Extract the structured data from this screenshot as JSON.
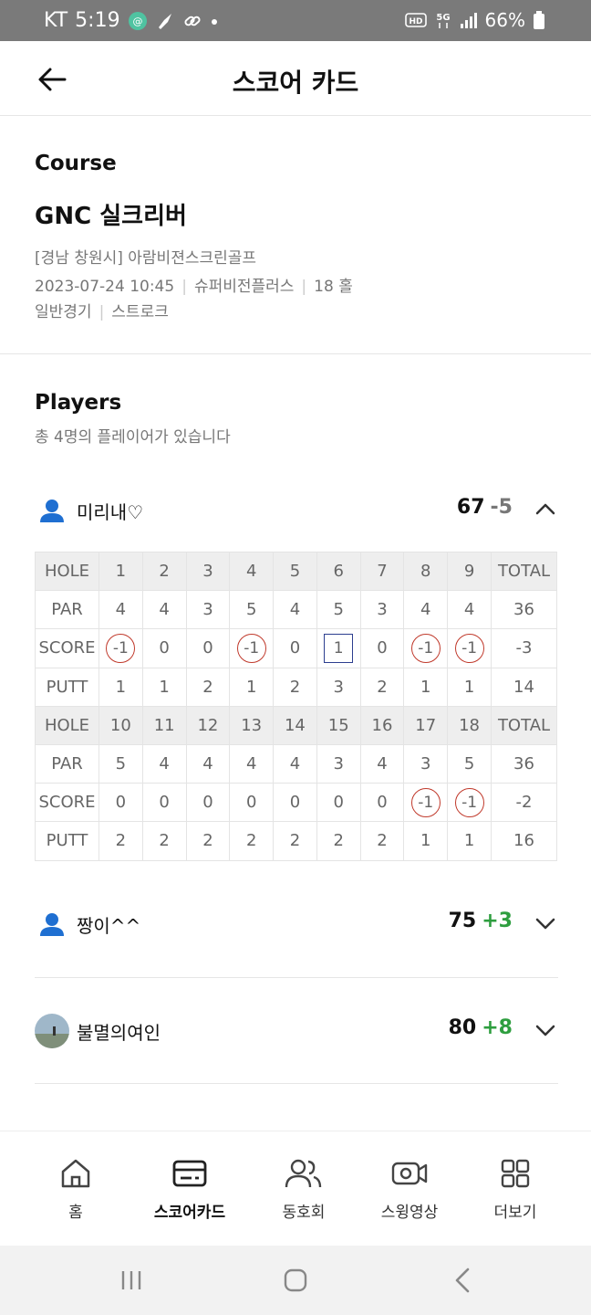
{
  "status": {
    "carrier": "KT",
    "time": "5:19",
    "battery": "66%",
    "icons_left": [
      "app-badge-icon",
      "rocket-icon",
      "link-icon",
      "dot-icon"
    ],
    "icons_right": [
      "hd-icon",
      "5g-icon",
      "signal-icon",
      "battery-icon"
    ]
  },
  "header": {
    "title": "스코어 카드",
    "back_icon": "arrow-left-icon"
  },
  "course": {
    "section_label": "Course",
    "name": "GNC 실크리버",
    "location": "[경남 창원시] 아람비젼스크린골프",
    "datetime": "2023-07-24 10:45",
    "system": "슈퍼비전플러스",
    "holes": "18 홀",
    "game_type": "일반경기",
    "mode": "스트로크"
  },
  "players": {
    "section_label": "Players",
    "count_text": "총 4명의 플레이어가 있습니다",
    "list": [
      {
        "name": "미리내♡",
        "score": "67",
        "diff": "-5",
        "diff_color": "#777777",
        "expanded": true
      },
      {
        "name": "짱이^^",
        "score": "75",
        "diff": "+3",
        "diff_color": "#2e9e3f",
        "expanded": false
      },
      {
        "name": "불멸의여인",
        "score": "80",
        "diff": "+8",
        "diff_color": "#2e9e3f",
        "expanded": false
      }
    ]
  },
  "scorecard": {
    "front": {
      "hole_label": "HOLE",
      "holes": [
        "1",
        "2",
        "3",
        "4",
        "5",
        "6",
        "7",
        "8",
        "9"
      ],
      "total_label": "TOTAL",
      "par_label": "PAR",
      "par": [
        "4",
        "4",
        "3",
        "5",
        "4",
        "5",
        "3",
        "4",
        "4"
      ],
      "par_total": "36",
      "score_label": "SCORE",
      "score": [
        "-1",
        "0",
        "0",
        "-1",
        "0",
        "1",
        "0",
        "-1",
        "-1"
      ],
      "score_mark": [
        "circle",
        "",
        "",
        "circle",
        "",
        "square",
        "",
        "circle",
        "circle"
      ],
      "score_total": "-3",
      "putt_label": "PUTT",
      "putt": [
        "1",
        "1",
        "2",
        "1",
        "2",
        "3",
        "2",
        "1",
        "1"
      ],
      "putt_total": "14"
    },
    "back": {
      "hole_label": "HOLE",
      "holes": [
        "10",
        "11",
        "12",
        "13",
        "14",
        "15",
        "16",
        "17",
        "18"
      ],
      "total_label": "TOTAL",
      "par_label": "PAR",
      "par": [
        "5",
        "4",
        "4",
        "4",
        "4",
        "3",
        "4",
        "3",
        "5"
      ],
      "par_total": "36",
      "score_label": "SCORE",
      "score": [
        "0",
        "0",
        "0",
        "0",
        "0",
        "0",
        "0",
        "-1",
        "-1"
      ],
      "score_mark": [
        "",
        "",
        "",
        "",
        "",
        "",
        "",
        "circle",
        "circle"
      ],
      "score_total": "-2",
      "putt_label": "PUTT",
      "putt": [
        "2",
        "2",
        "2",
        "2",
        "2",
        "2",
        "2",
        "1",
        "1"
      ],
      "putt_total": "16"
    }
  },
  "bottom_nav": [
    {
      "label": "홈",
      "icon": "home-icon",
      "active": false
    },
    {
      "label": "스코어카드",
      "icon": "scorecard-icon",
      "active": true
    },
    {
      "label": "동호회",
      "icon": "club-icon",
      "active": false
    },
    {
      "label": "스윙영상",
      "icon": "video-icon",
      "active": false
    },
    {
      "label": "더보기",
      "icon": "grid-icon",
      "active": false
    }
  ],
  "colors": {
    "accent_blue": "#1f6fd1",
    "positive_green": "#2e9e3f",
    "circle_red": "#c0392b",
    "square_navy": "#2c3e8f"
  }
}
